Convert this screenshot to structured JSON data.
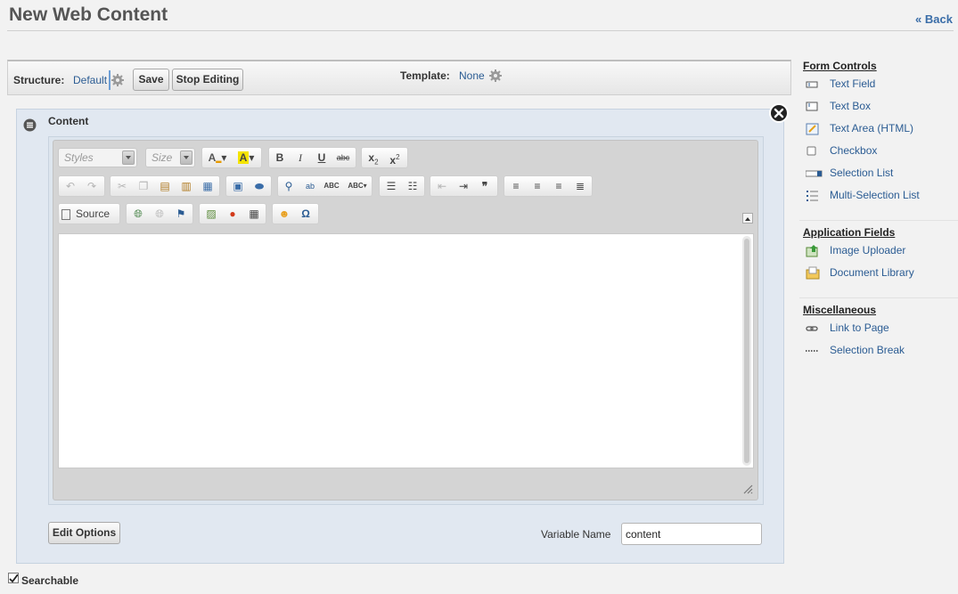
{
  "page": {
    "title": "New Web Content",
    "back_label": "« Back"
  },
  "structure_bar": {
    "structure_label": "Structure:",
    "structure_value": "Default",
    "save_label": "Save",
    "stop_editing_label": "Stop Editing",
    "template_label": "Template:",
    "template_value": "None"
  },
  "field": {
    "title": "Content",
    "edit_options_label": "Edit Options",
    "variable_name_label": "Variable Name",
    "variable_name_value": "content"
  },
  "editor": {
    "styles_placeholder": "Styles",
    "size_placeholder": "Size",
    "source_label": "Source",
    "toolbar_icons": [
      "text-color-icon",
      "bg-color-icon",
      "bold-icon",
      "italic-icon",
      "underline-icon",
      "strikethrough-icon",
      "subscript-icon",
      "superscript-icon",
      "undo-icon",
      "redo-icon",
      "cut-icon",
      "copy-icon",
      "paste-icon",
      "paste-text-icon",
      "paste-word-icon",
      "select-all-icon",
      "remove-format-icon",
      "find-icon",
      "replace-icon",
      "spellcheck-icon",
      "spellcheck-as-you-type-icon",
      "numbered-list-icon",
      "bulleted-list-icon",
      "outdent-icon",
      "indent-icon",
      "blockquote-icon",
      "align-left-icon",
      "align-center-icon",
      "align-right-icon",
      "justify-icon",
      "source-icon",
      "link-icon",
      "unlink-icon",
      "anchor-icon",
      "image-icon",
      "flash-icon",
      "table-icon",
      "smiley-icon",
      "special-char-icon"
    ]
  },
  "searchable": {
    "label": "Searchable",
    "checked": true
  },
  "sidebar": {
    "form_controls": {
      "heading": "Form Controls",
      "items": [
        {
          "label": "Text Field",
          "icon": "text-field-icon"
        },
        {
          "label": "Text Box",
          "icon": "text-box-icon"
        },
        {
          "label": "Text Area (HTML)",
          "icon": "text-area-html-icon"
        },
        {
          "label": "Checkbox",
          "icon": "checkbox-icon"
        },
        {
          "label": "Selection List",
          "icon": "selection-list-icon"
        },
        {
          "label": "Multi-Selection List",
          "icon": "multi-selection-list-icon"
        }
      ]
    },
    "application_fields": {
      "heading": "Application Fields",
      "items": [
        {
          "label": "Image Uploader",
          "icon": "image-uploader-icon"
        },
        {
          "label": "Document Library",
          "icon": "document-library-icon"
        }
      ]
    },
    "miscellaneous": {
      "heading": "Miscellaneous",
      "items": [
        {
          "label": "Link to Page",
          "icon": "link-to-page-icon"
        },
        {
          "label": "Selection Break",
          "icon": "selection-break-icon"
        }
      ]
    }
  },
  "colors": {
    "link": "#2b5c93",
    "panel_bg": "#e1e8f1",
    "accent": "#3a6da8"
  }
}
